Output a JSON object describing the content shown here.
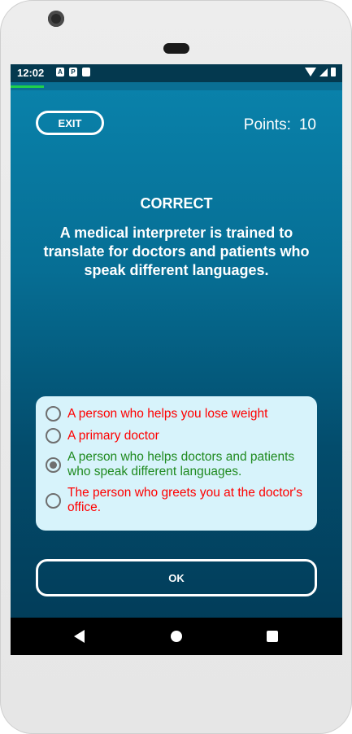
{
  "status_bar": {
    "time": "12:02",
    "notification_icons": [
      "A",
      "P",
      "card"
    ]
  },
  "quiz_progress": 0.1,
  "header": {
    "exit_label": "EXIT",
    "points_label": "Points:",
    "points_value": "10"
  },
  "feedback": {
    "result": "CORRECT",
    "explanation": "A medical interpreter is trained to translate for doctors and patients who speak different languages."
  },
  "answers": [
    {
      "text": "A person who helps you lose weight",
      "status": "wrong",
      "selected": false
    },
    {
      "text": "A primary doctor",
      "status": "wrong",
      "selected": false
    },
    {
      "text": "A person who helps doctors and patients who speak different languages.",
      "status": "right",
      "selected": true
    },
    {
      "text": "The person who greets you at the doctor's office.",
      "status": "wrong",
      "selected": false
    }
  ],
  "ok_label": "OK",
  "colors": {
    "correct_text": "#1f8a1f",
    "wrong_text": "#ff0000",
    "progress": "#1fd14a"
  }
}
